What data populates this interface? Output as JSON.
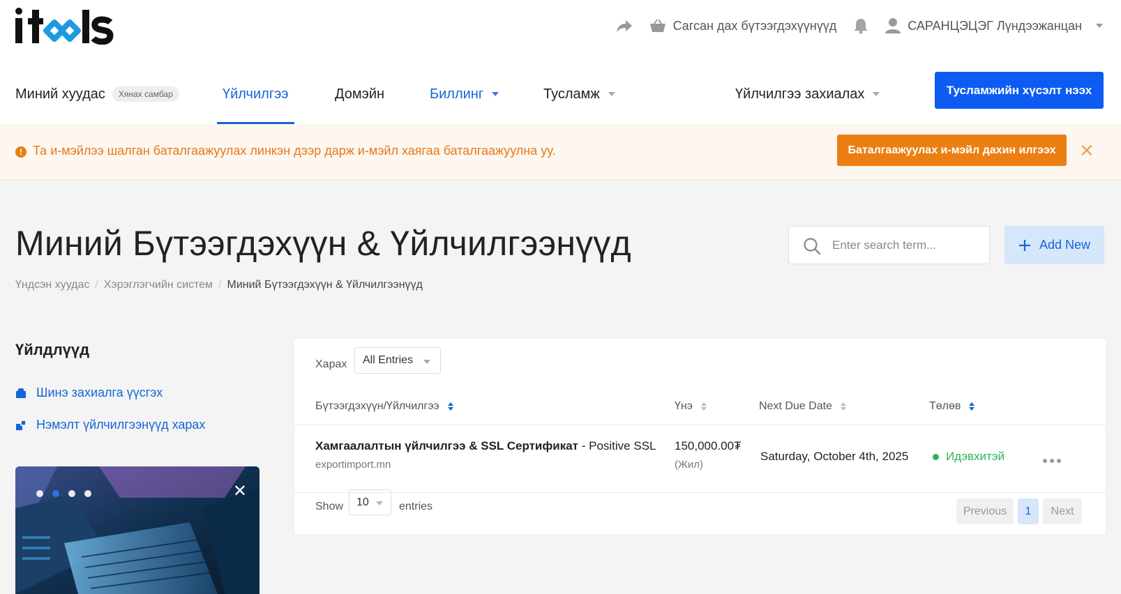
{
  "logo": {
    "text": "itools"
  },
  "header": {
    "cart_label": "Сагсан дах бүтээгдэхүүнүүд",
    "user_name": "САРАНЦЭЦЭГ Лүндээжанцан"
  },
  "nav": {
    "my_page": "Миний хуудас",
    "dashboard_badge": "Хянах самбар",
    "services": "Үйлчилгээ",
    "domains": "Домэйн",
    "billing": "Биллинг",
    "support": "Тусламж",
    "order_services": "Үйлчилгээ захиалах",
    "support_request_button": "Тусламжийн хүсэлт нээх"
  },
  "alert": {
    "message": "Та и-мэйлээ шалган баталгаажуулах линкэн дээр дарж и-мэйл хаягаа баталгаажуулна уу.",
    "resend_button": "Баталгаажуулах и-мэйл дахин илгээх",
    "close": "✕"
  },
  "page": {
    "title": "Миний Бүтээгдэхүүн & Үйлчилгээнүүд",
    "breadcrumb": [
      "Үндсэн хуудас",
      "Хэрэглэгчийн систем",
      "Миний Бүтээгдэхүүн & Үйлчилгээнүүд"
    ],
    "search_placeholder": "Enter search term...",
    "add_new": "Add New"
  },
  "sidebar": {
    "title": "Үйлдлүүд",
    "links": [
      "Шинэ захиалга үүсгэх",
      "Нэмэлт үйлчилгээнүүд харах"
    ],
    "promo_close": "✕"
  },
  "table": {
    "filter_label": "Харах",
    "filter_value": "All Entries",
    "columns": [
      "Бүтээгдэхүүн/Үйлчилгээ",
      "Үнэ",
      "Next Due Date",
      "Төлөв"
    ],
    "rows": [
      {
        "product_bold": "Хамгаалалтын үйлчилгээ & SSL Сертификат",
        "product_rest": " - Positive SSL",
        "domain": "exportimport.mn",
        "price": "150,000.00₮",
        "cycle": "(Жил)",
        "due_date": "Saturday, October 4th, 2025",
        "status": "Идэвхитэй"
      }
    ],
    "show_label": "Show",
    "page_size": "10",
    "entries_label": "entries",
    "pagination": {
      "previous": "Previous",
      "current": "1",
      "next": "Next"
    }
  },
  "colors": {
    "primary": "#0d5cf2",
    "link": "#1565d8",
    "warning": "#ec7f13",
    "success": "#2fb45a"
  }
}
